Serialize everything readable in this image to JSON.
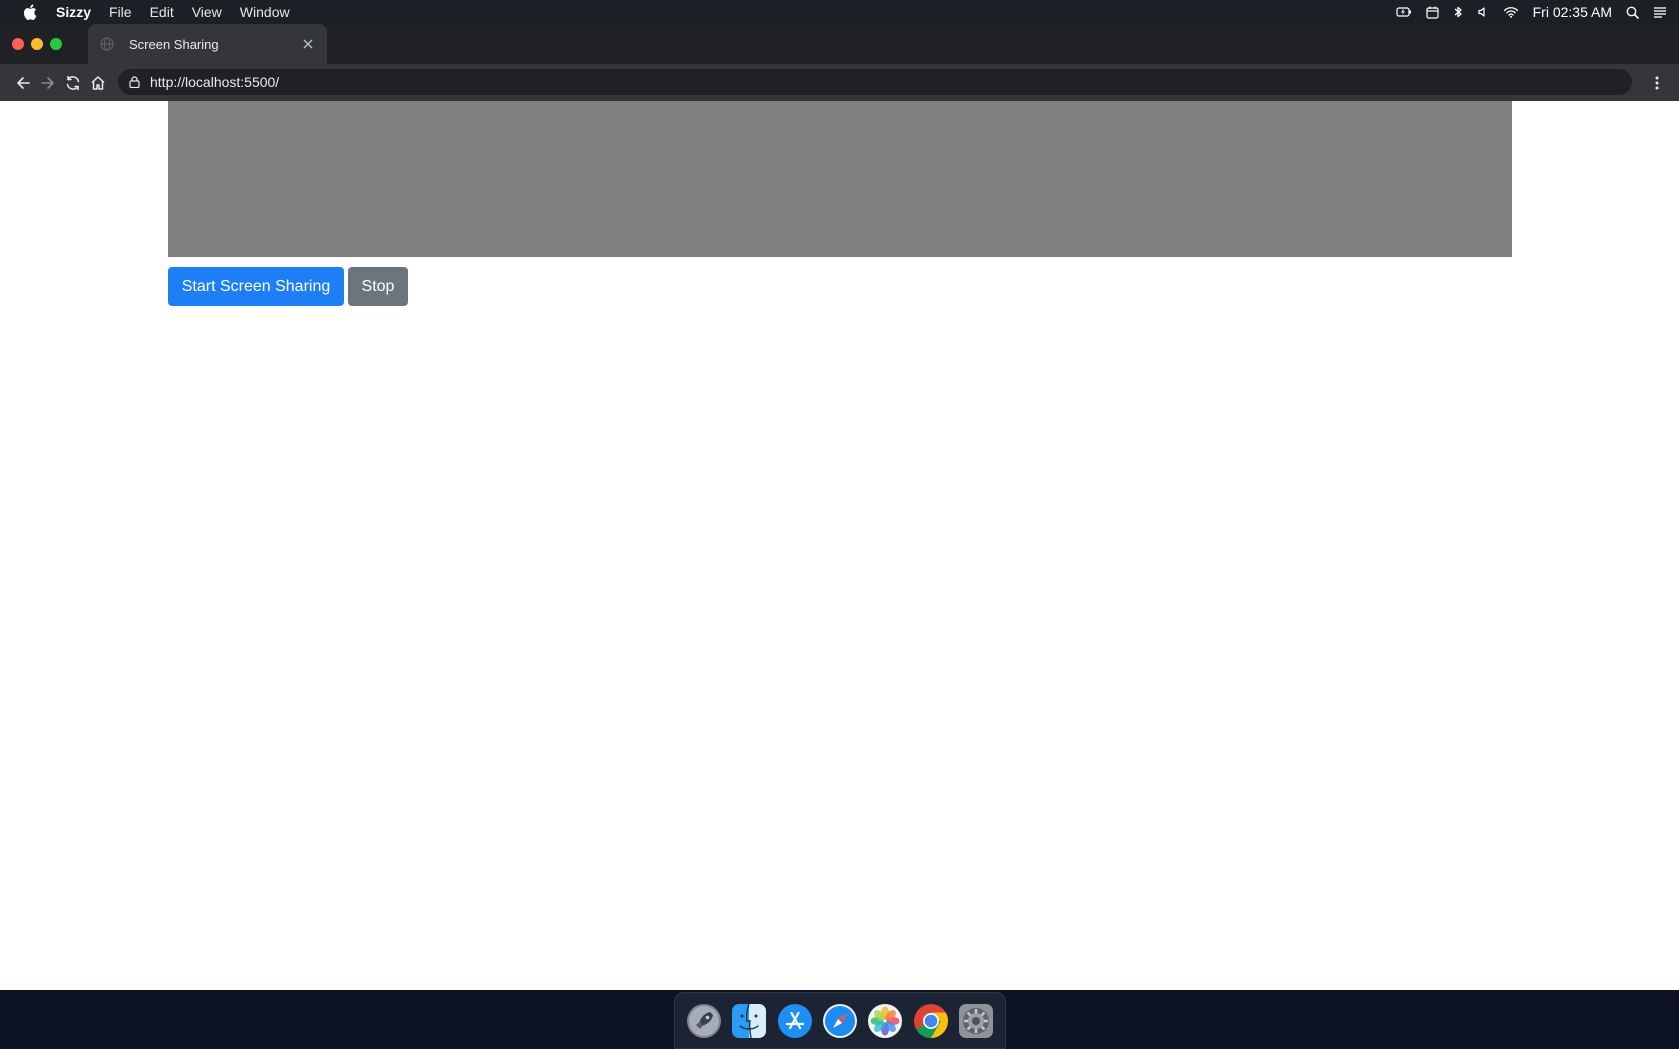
{
  "menubar": {
    "app_name": "Sizzy",
    "items": [
      "File",
      "Edit",
      "View",
      "Window"
    ],
    "clock": "Fri 02:35 AM"
  },
  "browser": {
    "tab": {
      "title": "Screen Sharing"
    },
    "address": {
      "url": "http://localhost:5500/"
    }
  },
  "page": {
    "video_area_color": "#808080",
    "start_button_label": "Start Screen Sharing",
    "stop_button_label": "Stop",
    "primary_color": "#1e7ef5",
    "secondary_color": "#6c757d"
  },
  "dock": {
    "apps": [
      "launchpad-icon",
      "finder-icon",
      "app-store-icon",
      "safari-icon",
      "photos-icon",
      "chrome-icon",
      "system-preferences-icon"
    ]
  }
}
